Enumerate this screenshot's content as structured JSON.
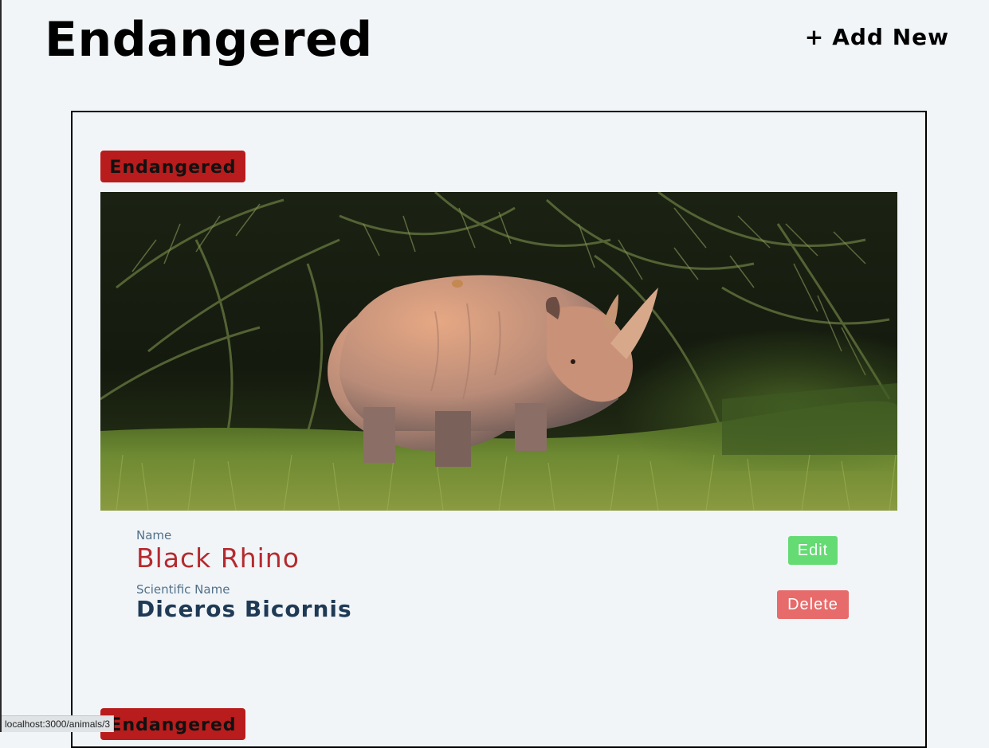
{
  "header": {
    "title": "Endangered",
    "add_new": {
      "icon": "plus-icon",
      "label": "Add New"
    }
  },
  "cards": [
    {
      "status": "Endangered",
      "status_color": "#b91c1c",
      "image": "black-rhino-photo",
      "name_label": "Name",
      "name": "Black Rhino",
      "scientific_label": "Scientific Name",
      "scientific_name": "Diceros Bicornis",
      "edit_label": "Edit",
      "delete_label": "Delete"
    },
    {
      "status": "Endangered",
      "status_color": "#b91c1c"
    }
  ],
  "status_bar": {
    "url": "localhost:3000/animals/3"
  },
  "colors": {
    "background": "#f1f5f8",
    "name": "#b52a2f",
    "scientific_name": "#1f3a55",
    "edit_button": "#64db73",
    "delete_button": "#e76b6b"
  }
}
